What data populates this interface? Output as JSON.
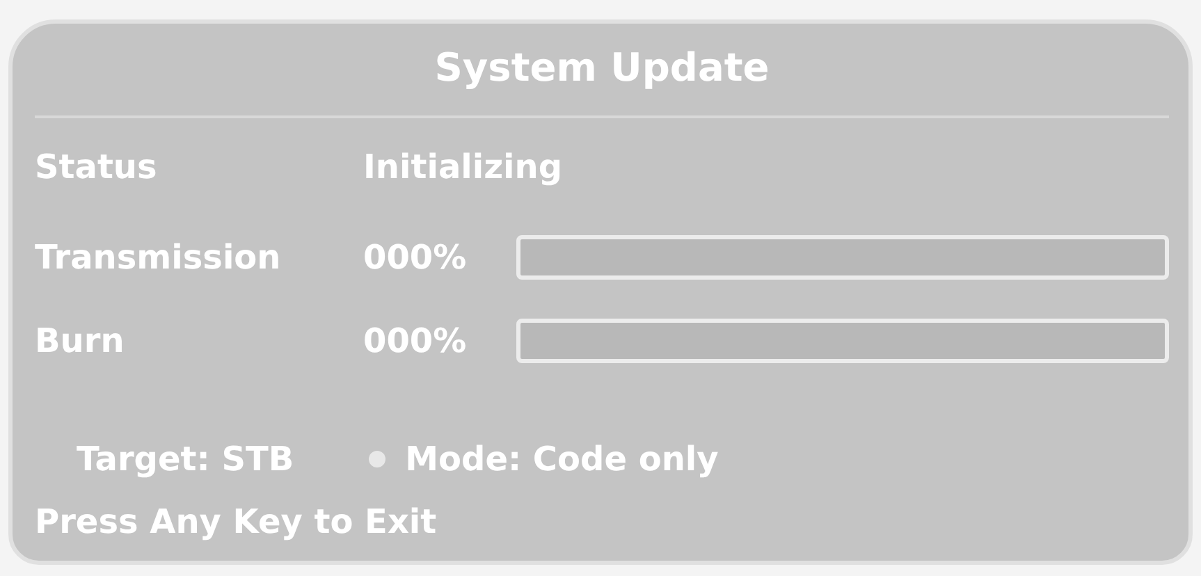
{
  "window": {
    "title": "System Update"
  },
  "status": {
    "label": "Status",
    "value": "Initializing"
  },
  "progress": [
    {
      "label": "Transmission",
      "reading": "000%",
      "level": 0
    },
    {
      "label": "Burn",
      "reading": "000%",
      "level": 0
    }
  ],
  "info": {
    "target": "Target: STB",
    "mode": "Mode: Code only"
  },
  "hint": "Press Any Key to Exit"
}
